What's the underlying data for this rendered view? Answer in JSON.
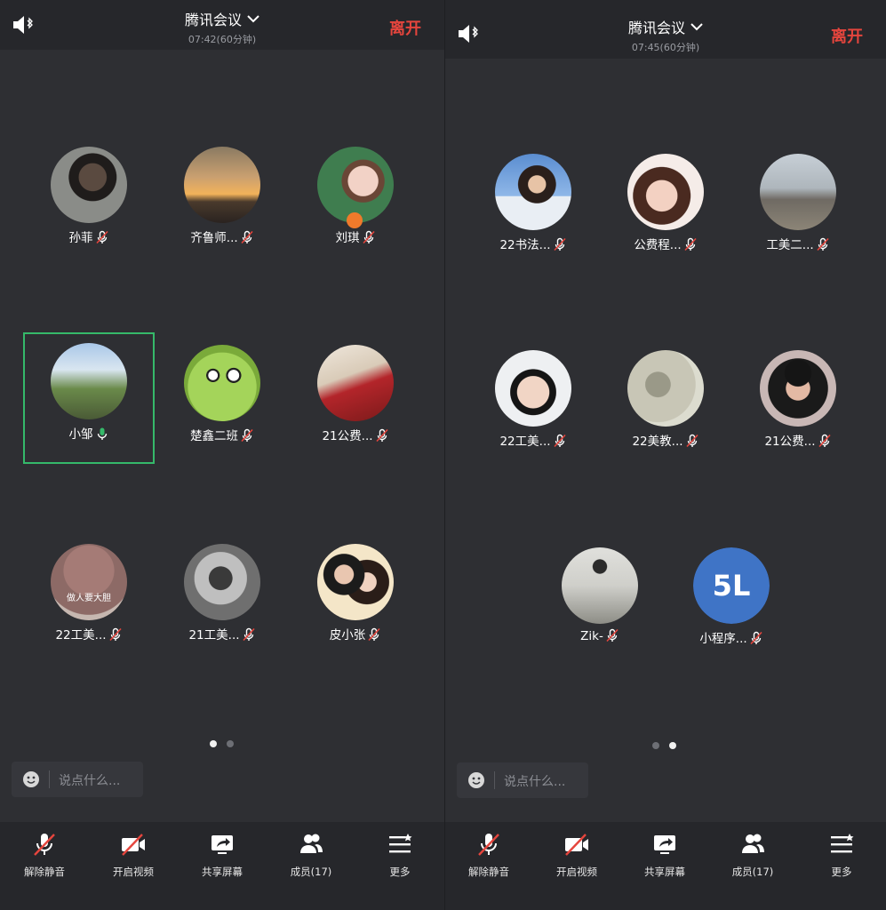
{
  "left": {
    "title": "腾讯会议",
    "timer": "07:42(60分钟)",
    "leave": "离开",
    "participants": [
      {
        "name": "孙菲",
        "mic": "muted"
      },
      {
        "name": "齐鲁师...",
        "mic": "muted"
      },
      {
        "name": "刘琪",
        "mic": "muted",
        "host_badge": true
      },
      {
        "name": "小邹",
        "mic": "speaking",
        "active": true
      },
      {
        "name": "楚鑫二班",
        "mic": "muted"
      },
      {
        "name": "21公费...",
        "mic": "muted"
      },
      {
        "name": "22工美...",
        "mic": "muted",
        "avatar_text": "做人要大胆"
      },
      {
        "name": "21工美...",
        "mic": "muted"
      },
      {
        "name": "皮小张",
        "mic": "muted"
      }
    ],
    "page_indicator": {
      "total": 2,
      "current": 1
    },
    "chat_placeholder": "说点什么..."
  },
  "right": {
    "title": "腾讯会议",
    "timer": "07:45(60分钟)",
    "leave": "离开",
    "participants": [
      {
        "name": "22书法...",
        "mic": "muted"
      },
      {
        "name": "公费程...",
        "mic": "muted"
      },
      {
        "name": "工美二...",
        "mic": "muted"
      },
      {
        "name": "22工美...",
        "mic": "muted"
      },
      {
        "name": "22美教...",
        "mic": "muted"
      },
      {
        "name": "21公费...",
        "mic": "muted"
      },
      {
        "name": "Zik-",
        "mic": "muted"
      },
      {
        "name": "小程序...",
        "mic": "muted",
        "initials": "5L"
      }
    ],
    "page_indicator": {
      "total": 2,
      "current": 2
    },
    "chat_placeholder": "说点什么..."
  },
  "toolbar": {
    "unmute": "解除静音",
    "video": "开启视频",
    "share": "共享屏幕",
    "members": "成员(17)",
    "more": "更多"
  },
  "colors": {
    "leave": "#e5453d",
    "active_border": "#35b96a",
    "speaking_mic": "#35b96a",
    "initials_bg": "#3f74c6"
  }
}
